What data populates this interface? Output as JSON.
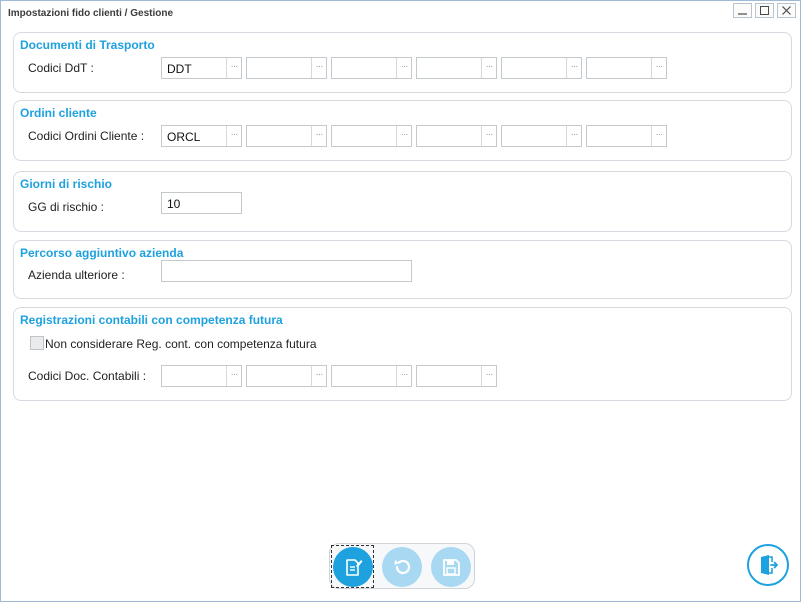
{
  "window": {
    "title": "Impostazioni fido clienti / Gestione",
    "controls": [
      "minimize-icon",
      "maximize-icon",
      "close-icon"
    ]
  },
  "ddt_group": {
    "title": "Documenti di Trasporto",
    "label": "Codici DdT :",
    "codes": [
      "DDT",
      "",
      "",
      "",
      "",
      ""
    ]
  },
  "orders_group": {
    "title": "Ordini cliente",
    "label": "Codici Ordini Cliente :",
    "codes": [
      "ORCL",
      "",
      "",
      "",
      "",
      ""
    ]
  },
  "risk_group": {
    "title": "Giorni di rischio",
    "label": "GG di rischio :",
    "value": "10"
  },
  "path_group": {
    "title": "Percorso aggiuntivo azienda",
    "label": "Azienda ulteriore :",
    "value": ""
  },
  "accounting_group": {
    "title": "Registrazioni contabili con competenza futura",
    "checkbox_label": "Non considerare Reg. cont. con competenza futura",
    "checkbox_checked": false,
    "label": "Codici Doc. Contabili :",
    "codes": [
      "",
      "",
      "",
      ""
    ]
  },
  "lookup_button_text": "···",
  "toolbar": {
    "buttons": [
      {
        "icon": "edit-document-icon",
        "state": "active"
      },
      {
        "icon": "undo-icon",
        "state": "disabled"
      },
      {
        "icon": "save-icon",
        "state": "disabled"
      }
    ]
  },
  "exit_button": {
    "icon": "exit-door-icon"
  },
  "colors": {
    "accent": "#1ea1df",
    "accent_disabled": "#a9d9f2",
    "group_border": "#d6dbe1",
    "title_text": "#3c3c3c"
  }
}
